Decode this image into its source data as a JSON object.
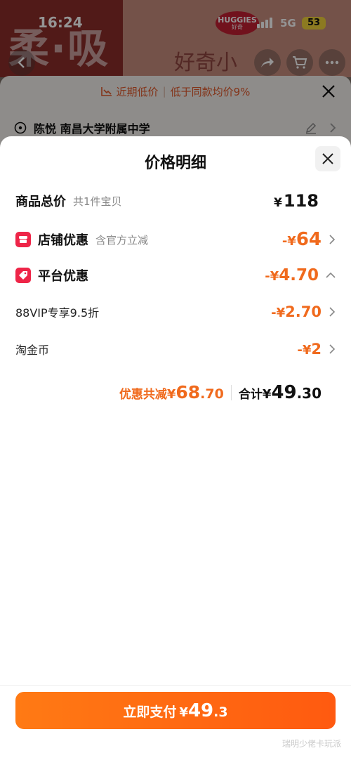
{
  "status_bar": {
    "time": "16:24",
    "network": "5G",
    "battery": "53"
  },
  "background": {
    "banner_text": "柔·吸",
    "banner_hand_text": "好奇小",
    "brand_name": "HUGGIES",
    "brand_sub": "好奇",
    "low_price_text": "近期低价",
    "low_price_detail": "低于同款均价9%",
    "address": "陈悦 南昌大学附属中学"
  },
  "sheet": {
    "title": "价格明细",
    "total": {
      "label": "商品总价",
      "sub": "共1件宝贝",
      "yen": "¥",
      "amount": "118"
    },
    "shop_discount": {
      "label": "店铺优惠",
      "sub": "含官方立减",
      "prefix": "-¥",
      "amount": "64"
    },
    "platform_discount": {
      "label": "平台优惠",
      "prefix": "-¥",
      "amount": "4.70"
    },
    "vip_discount": {
      "label": "88VIP专享9.5折",
      "prefix": "-¥",
      "amount": "2.70"
    },
    "coin_discount": {
      "label": "淘金币",
      "prefix": "-¥",
      "amount": "2"
    },
    "summary": {
      "discount_label": "优惠共减",
      "discount_yen": "¥",
      "discount_int": "68",
      "discount_dec": ".70",
      "total_label": "合计",
      "total_yen": "¥",
      "total_int": "49",
      "total_dec": ".30"
    },
    "pay_button": {
      "label": "立即支付",
      "yen": "¥",
      "int": "49",
      "dec": ".3"
    },
    "watermark": "瑞明少佬卡玩派"
  },
  "colors": {
    "accent": "#f06a1d",
    "badge": "#ee2548",
    "pay_button": "#ff6a12"
  }
}
